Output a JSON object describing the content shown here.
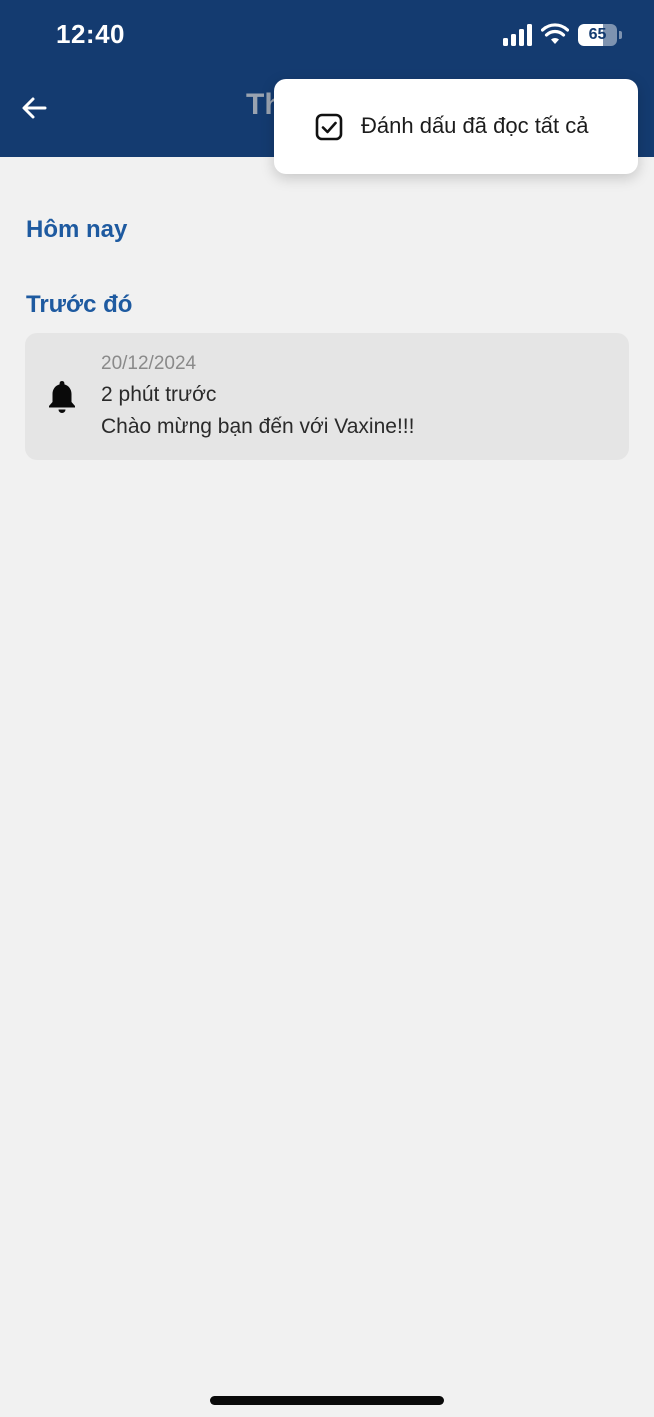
{
  "status_bar": {
    "time": "12:40",
    "battery_level": "65",
    "battery_fraction": 0.65,
    "icons": [
      "signal-icon",
      "wifi-icon",
      "battery-icon"
    ]
  },
  "header": {
    "back_icon": "arrow-left-icon",
    "title_partial": "Th",
    "background_color": "#143b70"
  },
  "popup_menu": {
    "items": [
      {
        "label": "Đánh dấu đã đọc tất cả",
        "icon": "checkbox-checked-icon"
      }
    ]
  },
  "sections": {
    "today": {
      "title": "Hôm nay"
    },
    "previous": {
      "title": "Trước đó"
    }
  },
  "notifications": [
    {
      "date": "20/12/2024",
      "relative_time": "2 phút trước",
      "message": "Chào mừng bạn đến với Vaxine!!!",
      "icon": "bell-icon"
    }
  ],
  "colors": {
    "accent": "#1e5aa0",
    "page_background": "#f1f1f1",
    "card_background": "#e5e5e5"
  }
}
